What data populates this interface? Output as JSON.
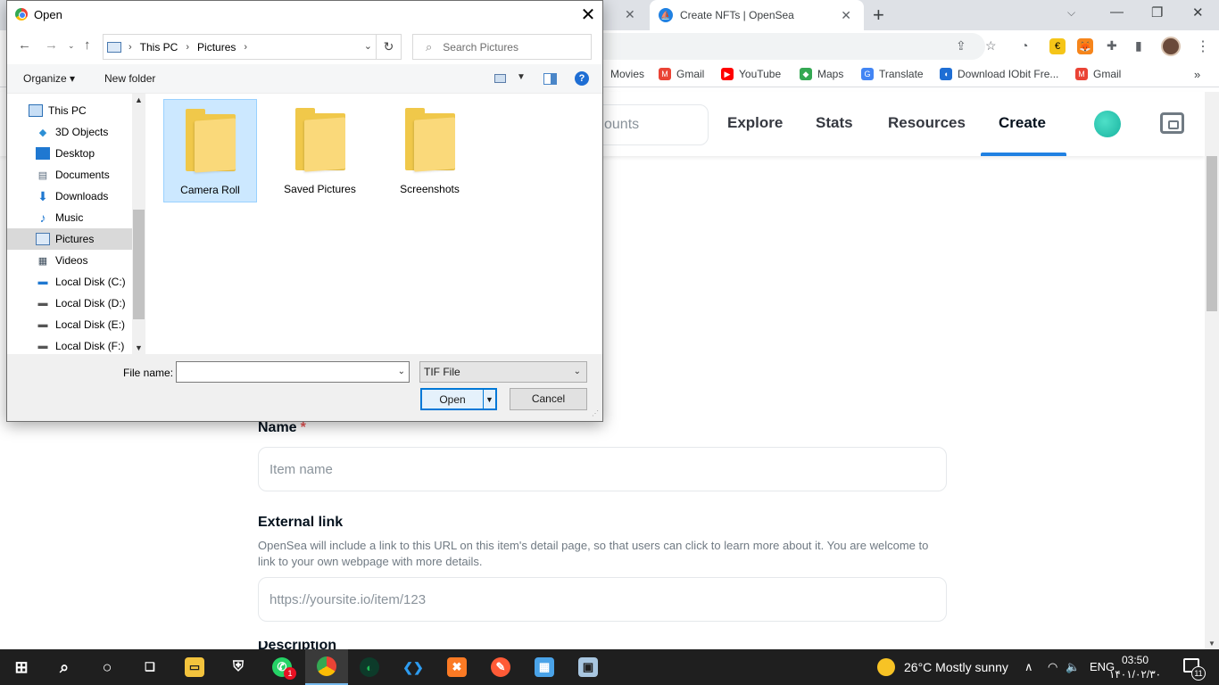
{
  "browser": {
    "tabs": [
      {
        "title": "Create NFTs | OpenSea",
        "active": true
      }
    ],
    "new_tab_symbol": "+",
    "window_controls": {
      "tab_search": "⌵",
      "minimize": "—",
      "restore": "❐",
      "close": "✕"
    },
    "bookmarks": [
      {
        "label": "Movies",
        "icon_color": ""
      },
      {
        "label": "Gmail",
        "icon_color": "#ea4335"
      },
      {
        "label": "YouTube",
        "icon_color": "#ff0000"
      },
      {
        "label": "Maps",
        "icon_color": "#34a853"
      },
      {
        "label": "Translate",
        "icon_color": "#4285f4"
      },
      {
        "label": "Download IObit Fre...",
        "icon_color": "#1e6ed4"
      },
      {
        "label": "Gmail",
        "icon_color": "#ea4335"
      }
    ],
    "bookmarks_more": "»"
  },
  "site": {
    "search_placeholder_fragment": "ounts",
    "nav": [
      {
        "label": "Explore"
      },
      {
        "label": "Stats"
      },
      {
        "label": "Resources"
      },
      {
        "label": "Create",
        "active": true
      }
    ],
    "accent_color": "#2081e2",
    "form": {
      "name_label": "Name",
      "required_mark": "*",
      "name_placeholder": "Item name",
      "external_link_label": "External link",
      "external_link_help": "OpenSea will include a link to this URL on this item's detail page, so that users can click to learn more about it. You are welcome to link to your own webpage with more details.",
      "external_link_placeholder": "https://yoursite.io/item/123",
      "description_label_peek": "Description"
    }
  },
  "dialog": {
    "title": "Open",
    "close_symbol": "✕",
    "path": [
      "This PC",
      "Pictures"
    ],
    "search_placeholder": "Search Pictures",
    "organize_label": "Organize ▾",
    "new_folder_label": "New folder",
    "help_symbol": "?",
    "nav_tree": [
      {
        "label": "This PC",
        "icon": "pc-icon",
        "indent": 0
      },
      {
        "label": "3D Objects",
        "icon": "3d-objects-icon",
        "indent": 1
      },
      {
        "label": "Desktop",
        "icon": "desktop-icon",
        "indent": 1
      },
      {
        "label": "Documents",
        "icon": "documents-icon",
        "indent": 1
      },
      {
        "label": "Downloads",
        "icon": "downloads-icon",
        "indent": 1
      },
      {
        "label": "Music",
        "icon": "music-icon",
        "indent": 1
      },
      {
        "label": "Pictures",
        "icon": "pictures-icon",
        "indent": 1,
        "selected": true
      },
      {
        "label": "Videos",
        "icon": "videos-icon",
        "indent": 1
      },
      {
        "label": "Local Disk (C:)",
        "icon": "windows-drive-icon",
        "indent": 1
      },
      {
        "label": "Local Disk (D:)",
        "icon": "drive-icon",
        "indent": 1
      },
      {
        "label": "Local Disk (E:)",
        "icon": "drive-icon",
        "indent": 1
      },
      {
        "label": "Local Disk (F:)",
        "icon": "drive-icon",
        "indent": 1
      }
    ],
    "folders": [
      {
        "label": "Camera Roll",
        "selected": true
      },
      {
        "label": "Saved Pictures",
        "selected": false
      },
      {
        "label": "Screenshots",
        "selected": false
      }
    ],
    "file_name_label": "File name:",
    "file_name_value": "",
    "file_type": "TIF File",
    "open_label": "Open",
    "cancel_label": "Cancel"
  },
  "taskbar": {
    "apps": [
      {
        "name": "start",
        "glyph": "⊞",
        "color": "#ffffff"
      },
      {
        "name": "search",
        "glyph": "⌕",
        "color": "#ffffff"
      },
      {
        "name": "cortana",
        "glyph": "○",
        "color": "#ffffff"
      },
      {
        "name": "task-view",
        "glyph": "❏",
        "color": "#ffffff"
      },
      {
        "name": "file-explorer",
        "glyph": "▭",
        "color": "#f3c33d"
      },
      {
        "name": "security",
        "glyph": "⛨",
        "color": "#ffffff"
      },
      {
        "name": "whatsapp",
        "glyph": "✆",
        "color": "#25d366",
        "badge": "1"
      },
      {
        "name": "chrome",
        "glyph": "◉",
        "color": "#ea4335",
        "active": true
      },
      {
        "name": "app-d",
        "glyph": "◐",
        "color": "#1db954"
      },
      {
        "name": "vscode",
        "glyph": "❮❯",
        "color": "#2d9cf0"
      },
      {
        "name": "xampp",
        "glyph": "✖",
        "color": "#fb7a24"
      },
      {
        "name": "app-pen",
        "glyph": "✎",
        "color": "#ff5a36"
      },
      {
        "name": "control-panel",
        "glyph": "▦",
        "color": "#4aa3e8"
      },
      {
        "name": "app-window",
        "glyph": "▣",
        "color": "#a8c6e0"
      }
    ],
    "weather": "26°C  Mostly sunny",
    "tray_chevron": "∧",
    "wifi": "◠",
    "volume": "🔈",
    "language": "ENG",
    "time": "03:50",
    "date": "۱۴۰۱/۰۲/۳۰",
    "notification_count": "11"
  }
}
